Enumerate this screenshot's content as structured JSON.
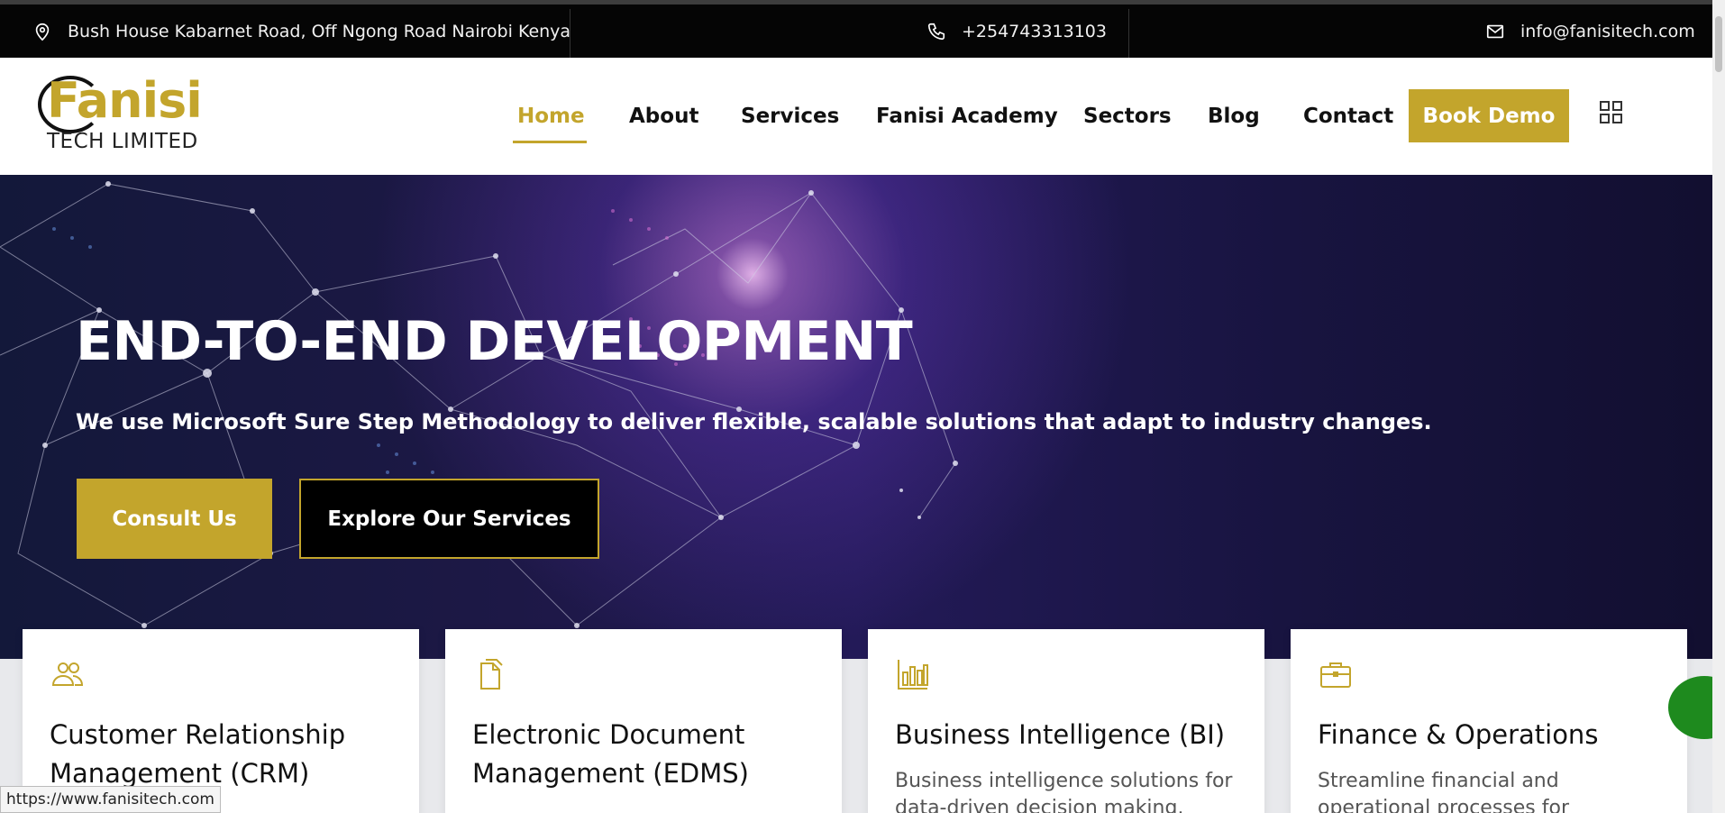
{
  "topbar": {
    "address": "Bush House Kabarnet Road, Off Ngong Road Nairobi Kenya",
    "phone": "+254743313103",
    "email": "info@fanisitech.com"
  },
  "logo": {
    "word": "Fanisi",
    "sub": "TECH LIMITED"
  },
  "nav": {
    "items": [
      "Home",
      "About",
      "Services",
      "Fanisi Academy",
      "Sectors",
      "Blog",
      "Contact"
    ],
    "active": "Home",
    "cta": "Book Demo"
  },
  "hero": {
    "title": "END-TO-END DEVELOPMENT",
    "subtitle": "We use Microsoft Sure Step Methodology to deliver flexible, scalable solutions that adapt to industry changes.",
    "primary_button": "Consult Us",
    "secondary_button": "Explore Our Services"
  },
  "cards": [
    {
      "icon": "users-icon",
      "title": "Customer Relationship Management (CRM)",
      "desc": ""
    },
    {
      "icon": "documents-icon",
      "title": "Electronic Document Management (EDMS)",
      "desc": ""
    },
    {
      "icon": "bar-chart-icon",
      "title": "Business Intelligence (BI)",
      "desc": "Business intelligence solutions for data-driven decision making."
    },
    {
      "icon": "briefcase-icon",
      "title": "Finance & Operations",
      "desc": "Streamline financial and operational processes for efficiency."
    }
  ],
  "status_url": "https://www.fanisitech.com",
  "colors": {
    "accent": "#c3a52c",
    "topbar": "#050505",
    "hero_dark": "#1d1846"
  }
}
